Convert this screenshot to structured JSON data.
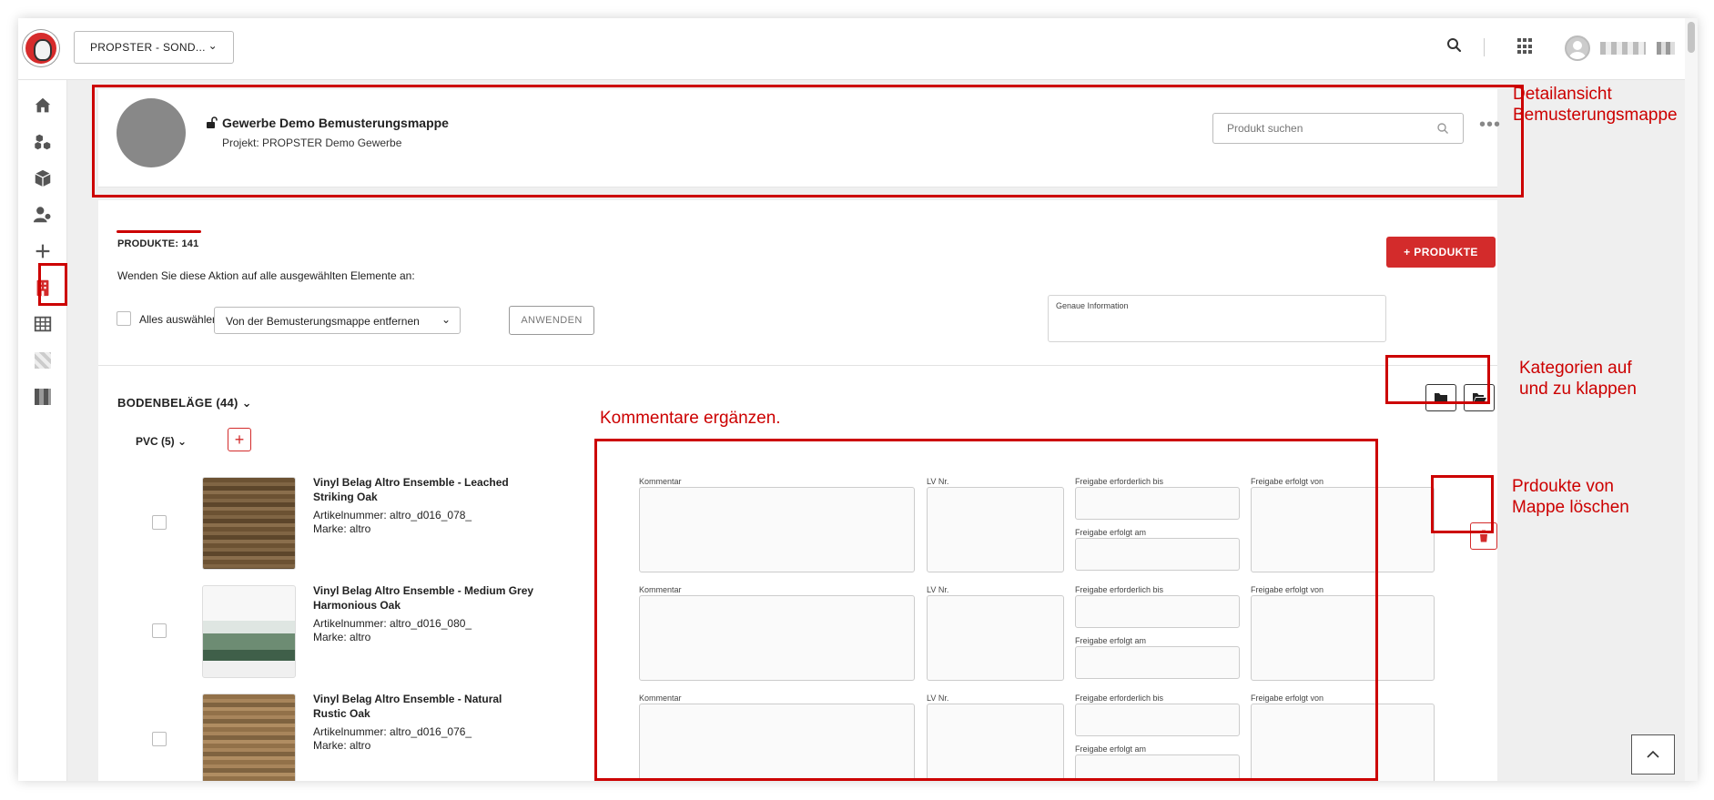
{
  "header": {
    "project_selector": "PROPSTER - SOND...",
    "icons": [
      "logo-icon",
      "search-icon",
      "apps-grid-icon",
      "user-avatar-icon"
    ]
  },
  "sidebar": {
    "items": [
      "home-icon",
      "cubes-icon",
      "box-icon",
      "user-group-icon",
      "plus-icon",
      "building-icon",
      "table-icon"
    ],
    "active": "building-icon"
  },
  "mappe": {
    "title": "Gewerbe Demo Bemusterungsmappe",
    "project": "Projekt: PROPSTER Demo Gewerbe",
    "search_placeholder": "Produkt suchen"
  },
  "products": {
    "count_label": "PRODUKTE: 141",
    "add_button": "+ PRODUKTE",
    "action_hint": "Wenden Sie diese Aktion auf alle ausgewählten Elemente an:",
    "select_all": "Alles auswählen",
    "bulk_action": "Von der Bemusterungsmappe entfernen",
    "apply_button": "ANWENDEN",
    "info_label": "Genaue Information"
  },
  "category": {
    "title": "BODENBELÄGE (44)",
    "subcategory": "PVC (5)",
    "add_subcategory": "+"
  },
  "fields": {
    "kommentar": "Kommentar",
    "lv_nr": "LV Nr.",
    "freigabe_bis": "Freigabe erforderlich bis",
    "freigabe_am": "Freigabe erfolgt am",
    "freigabe_von": "Freigabe erfolgt von"
  },
  "product_list": [
    {
      "name_line1": "Vinyl Belag Altro Ensemble - Leached",
      "name_line2": "Striking Oak",
      "article": "Artikelnummer: altro_d016_078_",
      "brand": "Marke: altro"
    },
    {
      "name_line1": "Vinyl Belag Altro Ensemble - Medium Grey",
      "name_line2": "Harmonious Oak",
      "article": "Artikelnummer: altro_d016_080_",
      "brand": "Marke: altro"
    },
    {
      "name_line1": "Vinyl Belag Altro Ensemble - Natural",
      "name_line2": "Rustic Oak",
      "article": "Artikelnummer: altro_d016_076_",
      "brand": "Marke: altro"
    }
  ],
  "annotations": {
    "detail_line1": "Detailansicht",
    "detail_line2": "Bemusterungsmappe",
    "kategorien_line1": "Kategorien auf",
    "kategorien_line2": "und zu klappen",
    "kommentare": "Kommentare ergänzen.",
    "loeschen_line1": "Prdoukte von",
    "loeschen_line2": "Mappe löschen"
  },
  "colors": {
    "accent": "#d32b2b",
    "annotation": "#cc0000"
  }
}
